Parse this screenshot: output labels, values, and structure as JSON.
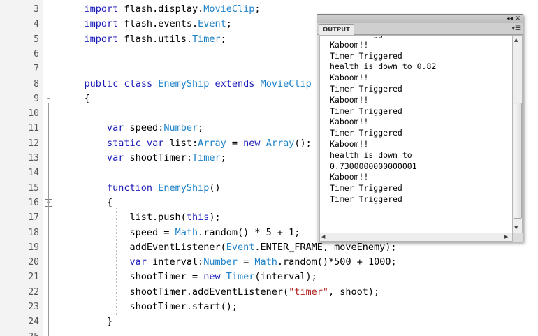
{
  "editor": {
    "lines": [
      {
        "num": "3",
        "tokens": [
          {
            "t": "    "
          },
          {
            "t": "import",
            "c": "kw"
          },
          {
            "t": " flash.display."
          },
          {
            "t": "MovieClip",
            "c": "ty"
          },
          {
            "t": ";"
          }
        ]
      },
      {
        "num": "4",
        "tokens": [
          {
            "t": "    "
          },
          {
            "t": "import",
            "c": "kw"
          },
          {
            "t": " flash.events."
          },
          {
            "t": "Event",
            "c": "ty"
          },
          {
            "t": ";"
          }
        ]
      },
      {
        "num": "5",
        "tokens": [
          {
            "t": "    "
          },
          {
            "t": "import",
            "c": "kw"
          },
          {
            "t": " flash.utils."
          },
          {
            "t": "Timer",
            "c": "ty"
          },
          {
            "t": ";"
          }
        ]
      },
      {
        "num": "6",
        "tokens": []
      },
      {
        "num": "7",
        "tokens": []
      },
      {
        "num": "8",
        "tokens": [
          {
            "t": "    "
          },
          {
            "t": "public",
            "c": "kw"
          },
          {
            "t": " "
          },
          {
            "t": "class",
            "c": "kw"
          },
          {
            "t": " "
          },
          {
            "t": "EnemyShip",
            "c": "ty"
          },
          {
            "t": " "
          },
          {
            "t": "extends",
            "c": "kw"
          },
          {
            "t": " "
          },
          {
            "t": "MovieClip",
            "c": "ty"
          }
        ]
      },
      {
        "num": "9",
        "tokens": [
          {
            "t": "    {"
          }
        ]
      },
      {
        "num": "10",
        "tokens": []
      },
      {
        "num": "11",
        "tokens": [
          {
            "t": "        "
          },
          {
            "t": "var",
            "c": "kw"
          },
          {
            "t": " speed:"
          },
          {
            "t": "Number",
            "c": "ty"
          },
          {
            "t": ";"
          }
        ]
      },
      {
        "num": "12",
        "tokens": [
          {
            "t": "        "
          },
          {
            "t": "static",
            "c": "kw"
          },
          {
            "t": " "
          },
          {
            "t": "var",
            "c": "kw"
          },
          {
            "t": " list:"
          },
          {
            "t": "Array",
            "c": "ty"
          },
          {
            "t": " = "
          },
          {
            "t": "new",
            "c": "kw"
          },
          {
            "t": " "
          },
          {
            "t": "Array",
            "c": "ty"
          },
          {
            "t": "();"
          }
        ]
      },
      {
        "num": "13",
        "tokens": [
          {
            "t": "        "
          },
          {
            "t": "var",
            "c": "kw"
          },
          {
            "t": " shootTimer:"
          },
          {
            "t": "Timer",
            "c": "ty"
          },
          {
            "t": ";"
          }
        ]
      },
      {
        "num": "14",
        "tokens": []
      },
      {
        "num": "15",
        "tokens": [
          {
            "t": "        "
          },
          {
            "t": "function",
            "c": "kw"
          },
          {
            "t": " "
          },
          {
            "t": "EnemyShip",
            "c": "ty"
          },
          {
            "t": "()"
          }
        ]
      },
      {
        "num": "16",
        "tokens": [
          {
            "t": "        {"
          }
        ]
      },
      {
        "num": "17",
        "tokens": [
          {
            "t": "            list.push("
          },
          {
            "t": "this",
            "c": "kw"
          },
          {
            "t": ");"
          }
        ]
      },
      {
        "num": "18",
        "tokens": [
          {
            "t": "            speed = "
          },
          {
            "t": "Math",
            "c": "ty"
          },
          {
            "t": ".random() * 5 + 1;"
          }
        ]
      },
      {
        "num": "19",
        "tokens": [
          {
            "t": "            addEventListener("
          },
          {
            "t": "Event",
            "c": "ty"
          },
          {
            "t": ".ENTER_FRAME, moveEnemy);"
          }
        ]
      },
      {
        "num": "20",
        "tokens": [
          {
            "t": "            "
          },
          {
            "t": "var",
            "c": "kw"
          },
          {
            "t": " interval:"
          },
          {
            "t": "Number",
            "c": "ty"
          },
          {
            "t": " = "
          },
          {
            "t": "Math",
            "c": "ty"
          },
          {
            "t": ".random()*500 + 1000;"
          }
        ]
      },
      {
        "num": "21",
        "tokens": [
          {
            "t": "            shootTimer = "
          },
          {
            "t": "new",
            "c": "kw"
          },
          {
            "t": " "
          },
          {
            "t": "Timer",
            "c": "ty"
          },
          {
            "t": "(interval);"
          }
        ]
      },
      {
        "num": "22",
        "tokens": [
          {
            "t": "            shootTimer.addEventListener("
          },
          {
            "t": "\"timer\"",
            "c": "str"
          },
          {
            "t": ", shoot);"
          }
        ]
      },
      {
        "num": "23",
        "tokens": [
          {
            "t": "            shootTimer.start();"
          }
        ]
      },
      {
        "num": "24",
        "tokens": [
          {
            "t": "        }"
          }
        ]
      },
      {
        "num": "25",
        "tokens": []
      }
    ]
  },
  "output_panel": {
    "tab_label": "OUTPUT",
    "collapse_glyph": "◂◂",
    "close_glyph": "✕",
    "menu_glyph": "▾☰",
    "lines": [
      "Timer Triggered",
      "Kaboom!!",
      "Timer Triggered",
      "health is down to 0.82",
      "Kaboom!!",
      "Timer Triggered",
      "Kaboom!!",
      "Timer Triggered",
      "Kaboom!!",
      "Timer Triggered",
      "Kaboom!!",
      "health is down to",
      "0.7300000000000001",
      "Kaboom!!",
      "Timer Triggered",
      "Timer Triggered"
    ]
  },
  "colors": {
    "keyword": "#1b1bb8",
    "type": "#1e82c8",
    "string": "#b22222"
  }
}
